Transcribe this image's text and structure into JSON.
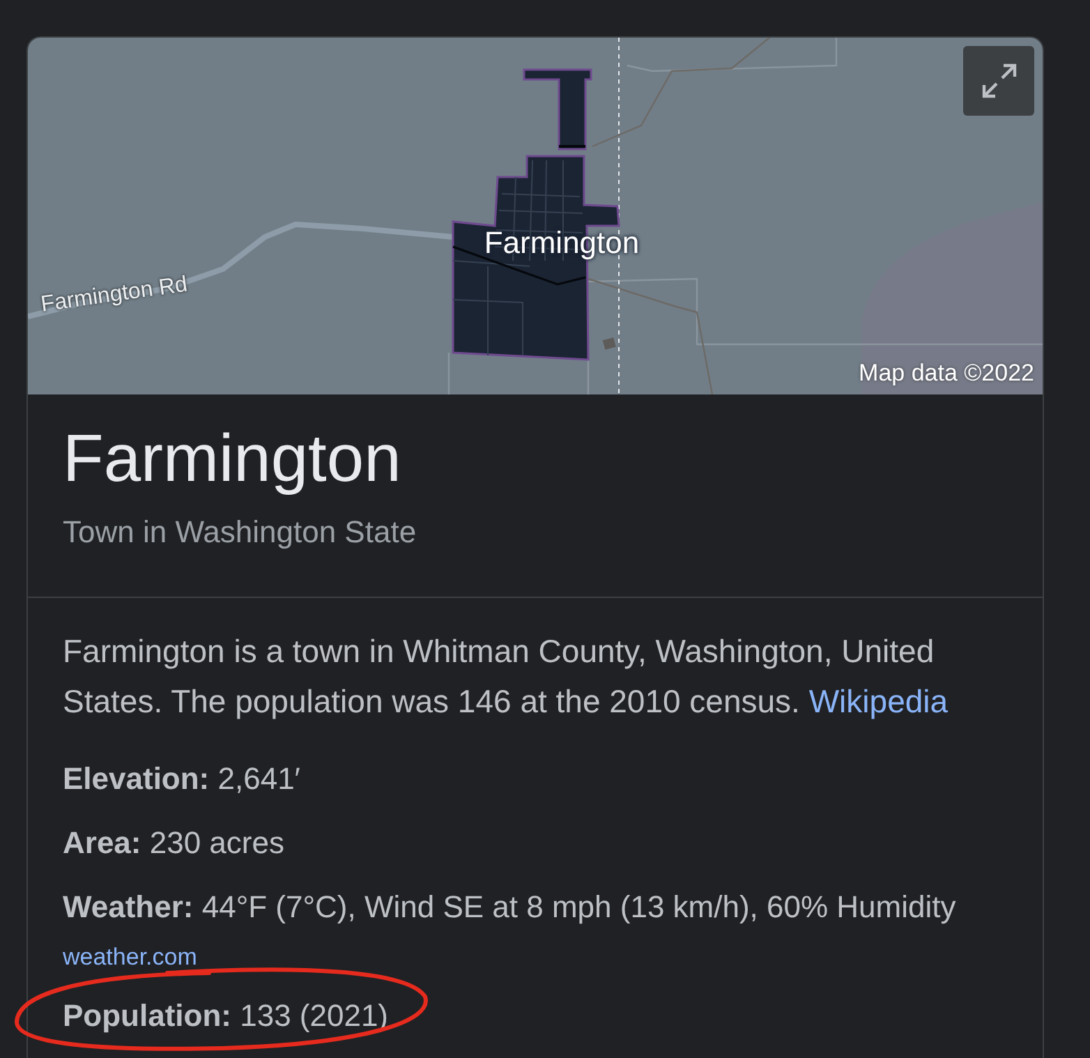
{
  "map": {
    "labels": [
      {
        "kind": "place",
        "text": "Farmington"
      },
      {
        "kind": "road",
        "text": "Farmington Rd"
      }
    ],
    "attribution": "Map data ©2022"
  },
  "title": "Farmington",
  "subtitle": "Town in Washington State",
  "description": {
    "text": "Farmington is a town in Whitman County, Washington, United States. The population was 146 at the 2010 census.",
    "source_link": "Wikipedia"
  },
  "facts": [
    {
      "text": "**Elevation:** 2,641′",
      "highlighted": false
    },
    {
      "text": "**Area:** 230 acres",
      "highlighted": false
    },
    {
      "text": "**Weather:** 44°F (7°C), Wind SE at 8 mph (13 km/h), 60% Humidity",
      "source_link": "weather.com",
      "highlighted": false
    },
    {
      "text": "**Population:** 133 (2021)",
      "highlighted": true
    }
  ]
}
